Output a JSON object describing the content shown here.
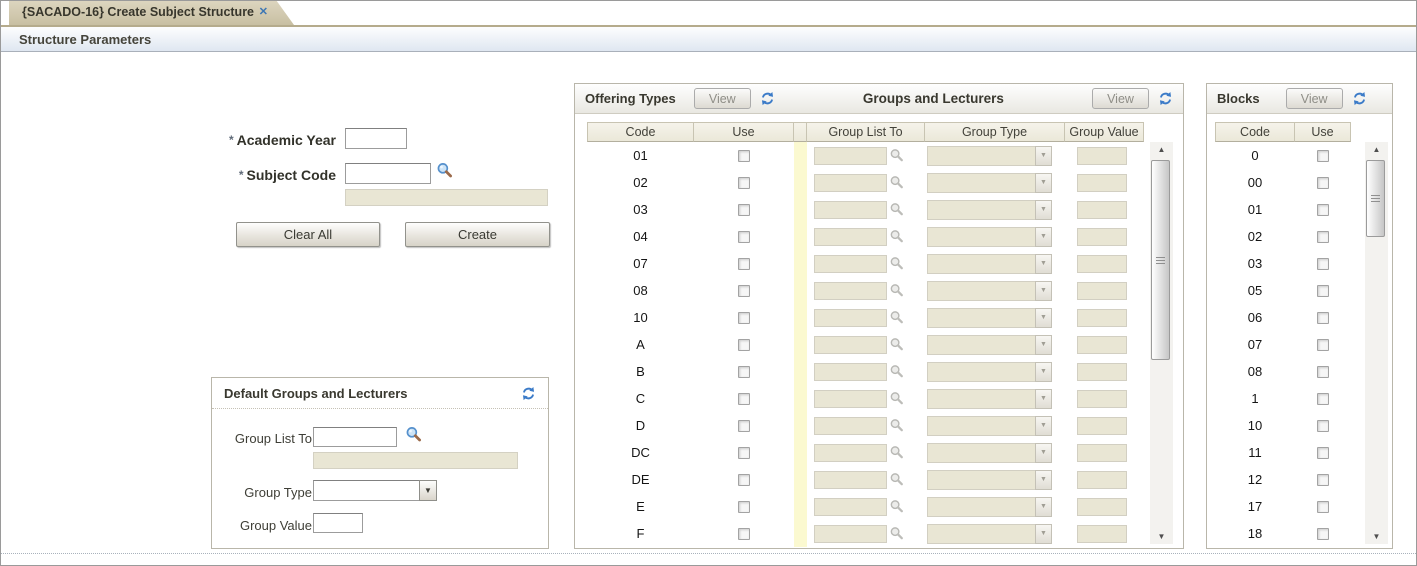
{
  "window": {
    "tab_title": "{SACADO-16} Create Subject Structure",
    "close_icon": "✕",
    "section_title": "Structure Parameters"
  },
  "form": {
    "required_marker": "*",
    "academic_year_label": "Academic Year",
    "academic_year_value": "",
    "subject_code_label": "Subject Code",
    "subject_code_value": "",
    "subject_code_description": "",
    "clear_all_button": "Clear All",
    "create_button": "Create"
  },
  "default_panel": {
    "title": "Default Groups and Lecturers",
    "group_list_to_label": "Group List To",
    "group_list_to_value": "",
    "group_list_to_description": "",
    "group_type_label": "Group Type",
    "group_type_value": "",
    "group_value_label": "Group Value",
    "group_value_value": ""
  },
  "offering_panel": {
    "title": "Offering Types",
    "groups_title": "Groups and Lecturers",
    "view_button": "View",
    "columns": {
      "code": "Code",
      "use": "Use",
      "group_list_to": "Group List To",
      "group_type": "Group Type",
      "group_value": "Group Value"
    },
    "rows": [
      {
        "code": "01",
        "use": false
      },
      {
        "code": "02",
        "use": false
      },
      {
        "code": "03",
        "use": false
      },
      {
        "code": "04",
        "use": false
      },
      {
        "code": "07",
        "use": false
      },
      {
        "code": "08",
        "use": false
      },
      {
        "code": "10",
        "use": false
      },
      {
        "code": "A",
        "use": false
      },
      {
        "code": "B",
        "use": false
      },
      {
        "code": "C",
        "use": false
      },
      {
        "code": "D",
        "use": false
      },
      {
        "code": "DC",
        "use": false
      },
      {
        "code": "DE",
        "use": false
      },
      {
        "code": "E",
        "use": false
      },
      {
        "code": "F",
        "use": false
      }
    ]
  },
  "blocks_panel": {
    "title": "Blocks",
    "view_button": "View",
    "columns": {
      "code": "Code",
      "use": "Use"
    },
    "rows": [
      {
        "code": "0",
        "use": false
      },
      {
        "code": "00",
        "use": false
      },
      {
        "code": "01",
        "use": false
      },
      {
        "code": "02",
        "use": false
      },
      {
        "code": "03",
        "use": false
      },
      {
        "code": "05",
        "use": false
      },
      {
        "code": "06",
        "use": false
      },
      {
        "code": "07",
        "use": false
      },
      {
        "code": "08",
        "use": false
      },
      {
        "code": "1",
        "use": false
      },
      {
        "code": "10",
        "use": false
      },
      {
        "code": "11",
        "use": false
      },
      {
        "code": "12",
        "use": false
      },
      {
        "code": "17",
        "use": false
      },
      {
        "code": "18",
        "use": false
      }
    ]
  },
  "icons": {
    "search": "magnifier",
    "refresh": "circular-arrows",
    "dropdown_arrow": "▼",
    "scroll_up": "▲",
    "scroll_down": "▼"
  },
  "colors": {
    "tab_bg": "#cdc4a7",
    "section_bar_gradient_end": "#dfe7f1",
    "panel_border": "#b9b6aa",
    "column_header_bg": "#f0ede1",
    "disabled_field_bg": "#e9e6d4",
    "highlight_band": "#fbf9d0",
    "accent_blue": "#3b7bc8"
  }
}
